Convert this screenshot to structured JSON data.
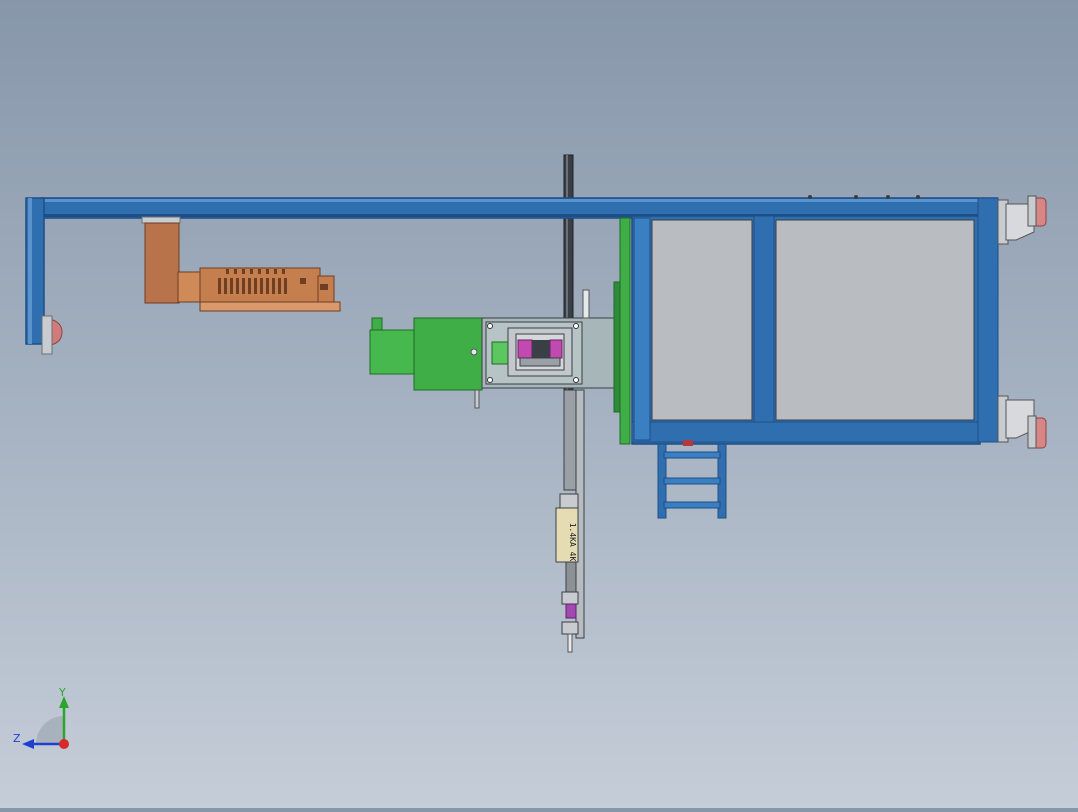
{
  "viewport": {
    "background_top": "#8797aa",
    "background_bottom": "#c5cdd8"
  },
  "colors": {
    "frame_blue": "#2f6fb0",
    "frame_blue_dark": "#1d4f86",
    "panel_gray": "#b9bdc2",
    "motor_green": "#3fae46",
    "copper": "#b8734a",
    "magenta": "#c04ab0",
    "rail_dark": "#3a3f45"
  },
  "part_label": "1.4KA 4K",
  "triad": {
    "y_label": "Y",
    "z_label": "Z"
  }
}
